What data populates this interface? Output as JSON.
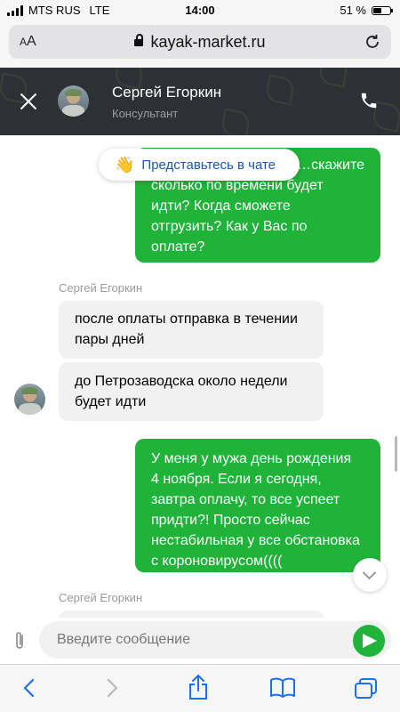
{
  "status_bar": {
    "carrier": "MTS RUS",
    "network": "LTE",
    "time": "14:00",
    "battery": "51 %",
    "battery_level": 0.51
  },
  "browser": {
    "text_size_label": "AA",
    "url": "kayak-market.ru"
  },
  "chat_header": {
    "agent_name": "Сергей Егоркин",
    "agent_role": "Консультант"
  },
  "intro_prompt": {
    "label": "Представьтесь в чате"
  },
  "messages": [
    {
      "direction": "out",
      "lines": [
        "…скажите",
        "сколько по времени будет",
        "идти? Когда сможете",
        "отгрузить? Как у Вас по",
        "оплате?"
      ]
    },
    {
      "direction": "in",
      "sender": "Сергей Егоркин",
      "lines": [
        "после оплаты отправка в течении",
        "пары дней"
      ]
    },
    {
      "direction": "in",
      "lines": [
        "до Петрозаводска около недели",
        "будет идти"
      ]
    },
    {
      "direction": "out",
      "lines": [
        "У меня у мужа день рождения",
        "4 ноября. Если я сегодня,",
        "завтра оплачу, то все успеет",
        "придти?! Просто сейчас",
        "нестабильная у все обстановка",
        "с короновирусом(((("
      ]
    },
    {
      "direction": "in",
      "sender": "Сергей Егоркин",
      "lines": []
    }
  ],
  "composer": {
    "placeholder": "Введите сообщение"
  },
  "colors": {
    "accent_green": "#1fb33a",
    "header_dark": "#2d3136",
    "link_blue": "#1d56a9"
  },
  "icons": [
    "close-icon",
    "phone-icon",
    "hand-icon",
    "paperclip-icon",
    "send-icon",
    "back-icon",
    "forward-icon",
    "share-icon",
    "bookmarks-icon",
    "tabs-icon",
    "reload-icon",
    "lock-icon"
  ]
}
